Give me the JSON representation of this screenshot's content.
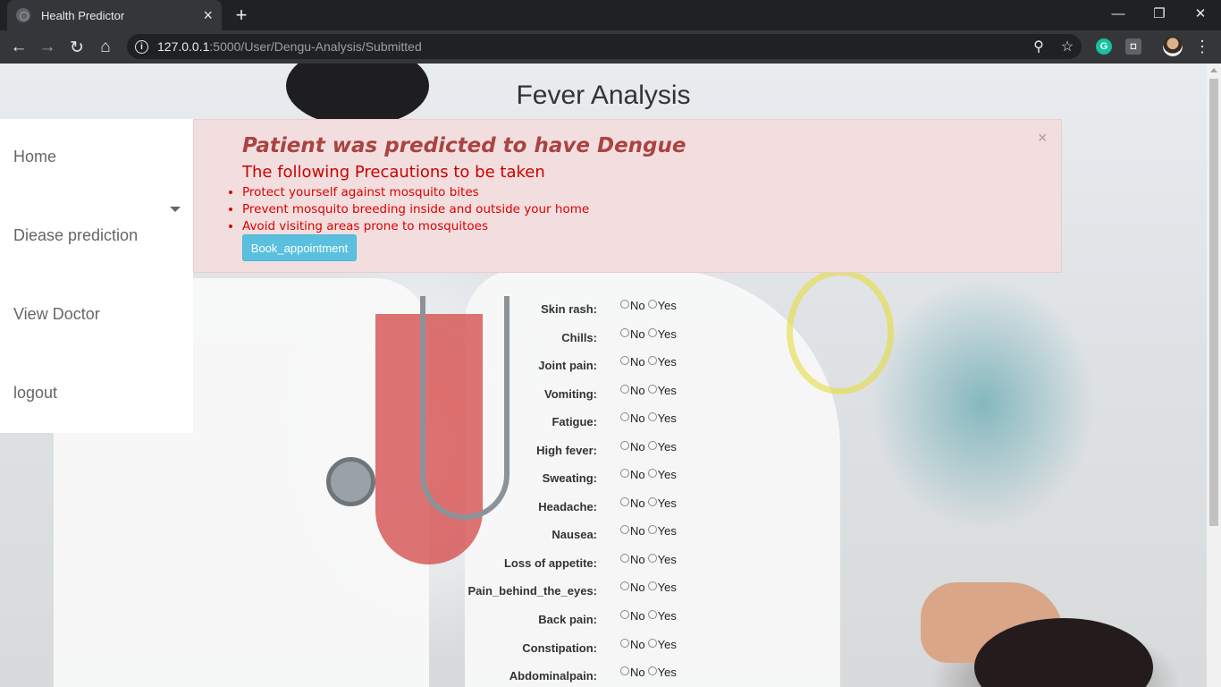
{
  "browser": {
    "tab_title": "Health Predictor",
    "tab_close": "×",
    "new_tab": "+",
    "url_host": "127.0.0.1",
    "url_rest": ":5000/User/Dengu-Analysis/Submitted",
    "win_minimize": "—",
    "win_restore": "❐",
    "win_close": "✕",
    "back": "←",
    "forward": "→",
    "reload": "↻",
    "home": "⌂",
    "zoom": "⚲",
    "star": "☆",
    "menu": "⋮"
  },
  "page": {
    "title": "Fever Analysis"
  },
  "sidebar": {
    "items": [
      {
        "label": "Home"
      },
      {
        "label": "Diease prediction"
      },
      {
        "label": "View Doctor"
      },
      {
        "label": "logout"
      }
    ]
  },
  "alert": {
    "close": "×",
    "heading": "Patient was predicted to have Dengue",
    "subheading": "The following Precautions to be taken",
    "precautions": [
      "Protect yourself against mosquito bites",
      "Prevent mosquito breeding inside and outside your home",
      "Avoid visiting areas prone to mosquitoes"
    ],
    "button": "Book_appointment"
  },
  "form": {
    "option_no": "No",
    "option_yes": "Yes",
    "symptoms": [
      "Skin rash:",
      "Chills:",
      "Joint pain:",
      "Vomiting:",
      "Fatigue:",
      "High fever:",
      "Sweating:",
      "Headache:",
      "Nausea:",
      "Loss of appetite:",
      "Pain_behind_the_eyes:",
      "Back pain:",
      "Constipation:",
      "Abdominalpain:"
    ]
  },
  "colors": {
    "alert_bg": "#f2dede",
    "alert_heading": "#a94442",
    "alert_text": "#dd0000",
    "button_bg": "#5bc0de"
  }
}
